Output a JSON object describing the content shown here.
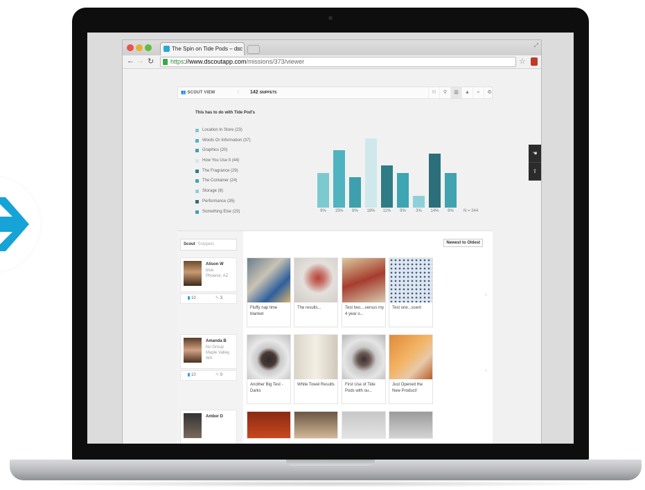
{
  "browser": {
    "tab_title": "The Spin on Tide Pods – dsc",
    "url_scheme": "https",
    "url_host": "://www.dscoutapp.com",
    "url_path": "/missions/373/viewer"
  },
  "header": {
    "scout_view_label": "SCOUT VIEW",
    "snippet_count": "142",
    "snippet_label": "SNIPPETS",
    "icons": [
      "people-icon",
      "pin-icon",
      "bar-chart-icon",
      "mountain-icon",
      "search-icon",
      "gear-icon"
    ],
    "active_icon": "bar-chart-icon"
  },
  "chart_data": {
    "type": "bar",
    "title": "This has to do with Tide Pod's",
    "categories": [
      "Location In Store",
      "Words Or Information",
      "Graphics",
      "How You Use It",
      "The Fragrance",
      "The Container",
      "Storage",
      "Performance",
      "Something Else"
    ],
    "counts": [
      23,
      37,
      20,
      44,
      29,
      24,
      8,
      35,
      23
    ],
    "values": [
      9,
      15,
      8,
      18,
      11,
      9,
      3,
      14,
      9
    ],
    "value_labels": [
      "9%",
      "15%",
      "8%",
      "18%",
      "11%",
      "9%",
      "3%",
      "14%",
      "9%"
    ],
    "colors": [
      "#7ccad0",
      "#4fb3c0",
      "#3ea0ad",
      "#cfe8ec",
      "#2f7c86",
      "#3ea5b2",
      "#8fd0d8",
      "#2a6f79",
      "#40a3af"
    ],
    "n_label": "N = 244",
    "ylim": [
      0,
      18
    ]
  },
  "list": {
    "segment_scout": "Scout",
    "segment_snippets": "Snippets",
    "sort_label": "Newest to Oldest",
    "scouts": [
      {
        "name": "Alison W",
        "line1": "blue",
        "line2": "Phoenix, AZ",
        "stat_a": "10",
        "stat_b": "3",
        "snippets": [
          "Fluffy nap time blanket",
          "The results...",
          "Test two....versus my 4 year o...",
          "Test one...scent"
        ]
      },
      {
        "name": "Amanda B",
        "line1": "No Group",
        "line2": "Maple Valley, WA",
        "stat_a": "10",
        "stat_b": "0",
        "snippets": [
          "Another Big Test - Darks",
          "White Towel Results",
          "First Use of Tide Pods with ou...",
          "Just Opened the New Product!"
        ]
      },
      {
        "name": "Amber D"
      }
    ]
  },
  "side_controls": [
    "hand-icon",
    "share-icon"
  ],
  "colors": {
    "accent": "#2aa8d8",
    "bezel": "#0e0e0e"
  }
}
